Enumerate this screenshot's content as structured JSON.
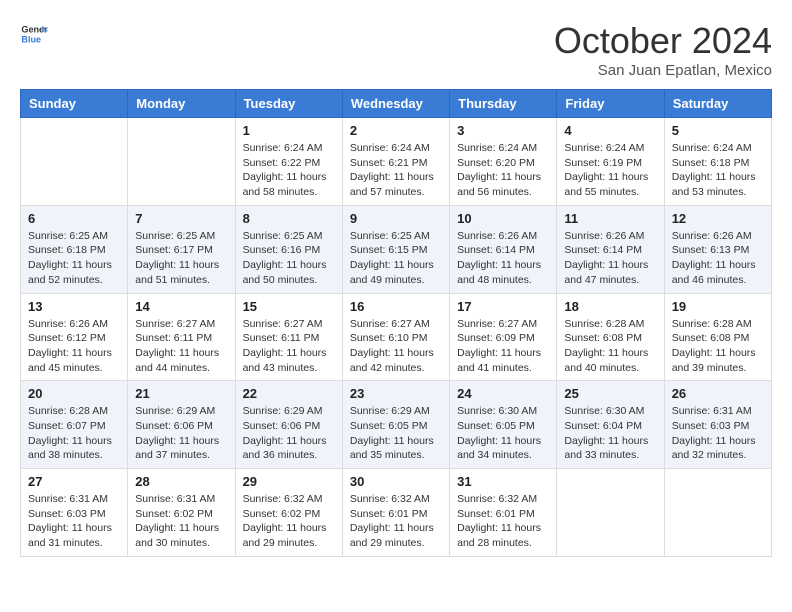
{
  "header": {
    "logo": {
      "general": "General",
      "blue": "Blue"
    },
    "title": "October 2024",
    "location": "San Juan Epatlan, Mexico"
  },
  "weekdays": [
    "Sunday",
    "Monday",
    "Tuesday",
    "Wednesday",
    "Thursday",
    "Friday",
    "Saturday"
  ],
  "weeks": [
    [
      {
        "day": "",
        "sunrise": "",
        "sunset": "",
        "daylight": "",
        "empty": true
      },
      {
        "day": "",
        "sunrise": "",
        "sunset": "",
        "daylight": "",
        "empty": true
      },
      {
        "day": "1",
        "sunrise": "Sunrise: 6:24 AM",
        "sunset": "Sunset: 6:22 PM",
        "daylight": "Daylight: 11 hours and 58 minutes."
      },
      {
        "day": "2",
        "sunrise": "Sunrise: 6:24 AM",
        "sunset": "Sunset: 6:21 PM",
        "daylight": "Daylight: 11 hours and 57 minutes."
      },
      {
        "day": "3",
        "sunrise": "Sunrise: 6:24 AM",
        "sunset": "Sunset: 6:20 PM",
        "daylight": "Daylight: 11 hours and 56 minutes."
      },
      {
        "day": "4",
        "sunrise": "Sunrise: 6:24 AM",
        "sunset": "Sunset: 6:19 PM",
        "daylight": "Daylight: 11 hours and 55 minutes."
      },
      {
        "day": "5",
        "sunrise": "Sunrise: 6:24 AM",
        "sunset": "Sunset: 6:18 PM",
        "daylight": "Daylight: 11 hours and 53 minutes."
      }
    ],
    [
      {
        "day": "6",
        "sunrise": "Sunrise: 6:25 AM",
        "sunset": "Sunset: 6:18 PM",
        "daylight": "Daylight: 11 hours and 52 minutes."
      },
      {
        "day": "7",
        "sunrise": "Sunrise: 6:25 AM",
        "sunset": "Sunset: 6:17 PM",
        "daylight": "Daylight: 11 hours and 51 minutes."
      },
      {
        "day": "8",
        "sunrise": "Sunrise: 6:25 AM",
        "sunset": "Sunset: 6:16 PM",
        "daylight": "Daylight: 11 hours and 50 minutes."
      },
      {
        "day": "9",
        "sunrise": "Sunrise: 6:25 AM",
        "sunset": "Sunset: 6:15 PM",
        "daylight": "Daylight: 11 hours and 49 minutes."
      },
      {
        "day": "10",
        "sunrise": "Sunrise: 6:26 AM",
        "sunset": "Sunset: 6:14 PM",
        "daylight": "Daylight: 11 hours and 48 minutes."
      },
      {
        "day": "11",
        "sunrise": "Sunrise: 6:26 AM",
        "sunset": "Sunset: 6:14 PM",
        "daylight": "Daylight: 11 hours and 47 minutes."
      },
      {
        "day": "12",
        "sunrise": "Sunrise: 6:26 AM",
        "sunset": "Sunset: 6:13 PM",
        "daylight": "Daylight: 11 hours and 46 minutes."
      }
    ],
    [
      {
        "day": "13",
        "sunrise": "Sunrise: 6:26 AM",
        "sunset": "Sunset: 6:12 PM",
        "daylight": "Daylight: 11 hours and 45 minutes."
      },
      {
        "day": "14",
        "sunrise": "Sunrise: 6:27 AM",
        "sunset": "Sunset: 6:11 PM",
        "daylight": "Daylight: 11 hours and 44 minutes."
      },
      {
        "day": "15",
        "sunrise": "Sunrise: 6:27 AM",
        "sunset": "Sunset: 6:11 PM",
        "daylight": "Daylight: 11 hours and 43 minutes."
      },
      {
        "day": "16",
        "sunrise": "Sunrise: 6:27 AM",
        "sunset": "Sunset: 6:10 PM",
        "daylight": "Daylight: 11 hours and 42 minutes."
      },
      {
        "day": "17",
        "sunrise": "Sunrise: 6:27 AM",
        "sunset": "Sunset: 6:09 PM",
        "daylight": "Daylight: 11 hours and 41 minutes."
      },
      {
        "day": "18",
        "sunrise": "Sunrise: 6:28 AM",
        "sunset": "Sunset: 6:08 PM",
        "daylight": "Daylight: 11 hours and 40 minutes."
      },
      {
        "day": "19",
        "sunrise": "Sunrise: 6:28 AM",
        "sunset": "Sunset: 6:08 PM",
        "daylight": "Daylight: 11 hours and 39 minutes."
      }
    ],
    [
      {
        "day": "20",
        "sunrise": "Sunrise: 6:28 AM",
        "sunset": "Sunset: 6:07 PM",
        "daylight": "Daylight: 11 hours and 38 minutes."
      },
      {
        "day": "21",
        "sunrise": "Sunrise: 6:29 AM",
        "sunset": "Sunset: 6:06 PM",
        "daylight": "Daylight: 11 hours and 37 minutes."
      },
      {
        "day": "22",
        "sunrise": "Sunrise: 6:29 AM",
        "sunset": "Sunset: 6:06 PM",
        "daylight": "Daylight: 11 hours and 36 minutes."
      },
      {
        "day": "23",
        "sunrise": "Sunrise: 6:29 AM",
        "sunset": "Sunset: 6:05 PM",
        "daylight": "Daylight: 11 hours and 35 minutes."
      },
      {
        "day": "24",
        "sunrise": "Sunrise: 6:30 AM",
        "sunset": "Sunset: 6:05 PM",
        "daylight": "Daylight: 11 hours and 34 minutes."
      },
      {
        "day": "25",
        "sunrise": "Sunrise: 6:30 AM",
        "sunset": "Sunset: 6:04 PM",
        "daylight": "Daylight: 11 hours and 33 minutes."
      },
      {
        "day": "26",
        "sunrise": "Sunrise: 6:31 AM",
        "sunset": "Sunset: 6:03 PM",
        "daylight": "Daylight: 11 hours and 32 minutes."
      }
    ],
    [
      {
        "day": "27",
        "sunrise": "Sunrise: 6:31 AM",
        "sunset": "Sunset: 6:03 PM",
        "daylight": "Daylight: 11 hours and 31 minutes."
      },
      {
        "day": "28",
        "sunrise": "Sunrise: 6:31 AM",
        "sunset": "Sunset: 6:02 PM",
        "daylight": "Daylight: 11 hours and 30 minutes."
      },
      {
        "day": "29",
        "sunrise": "Sunrise: 6:32 AM",
        "sunset": "Sunset: 6:02 PM",
        "daylight": "Daylight: 11 hours and 29 minutes."
      },
      {
        "day": "30",
        "sunrise": "Sunrise: 6:32 AM",
        "sunset": "Sunset: 6:01 PM",
        "daylight": "Daylight: 11 hours and 29 minutes."
      },
      {
        "day": "31",
        "sunrise": "Sunrise: 6:32 AM",
        "sunset": "Sunset: 6:01 PM",
        "daylight": "Daylight: 11 hours and 28 minutes."
      },
      {
        "day": "",
        "sunrise": "",
        "sunset": "",
        "daylight": "",
        "empty": true
      },
      {
        "day": "",
        "sunrise": "",
        "sunset": "",
        "daylight": "",
        "empty": true
      }
    ]
  ]
}
